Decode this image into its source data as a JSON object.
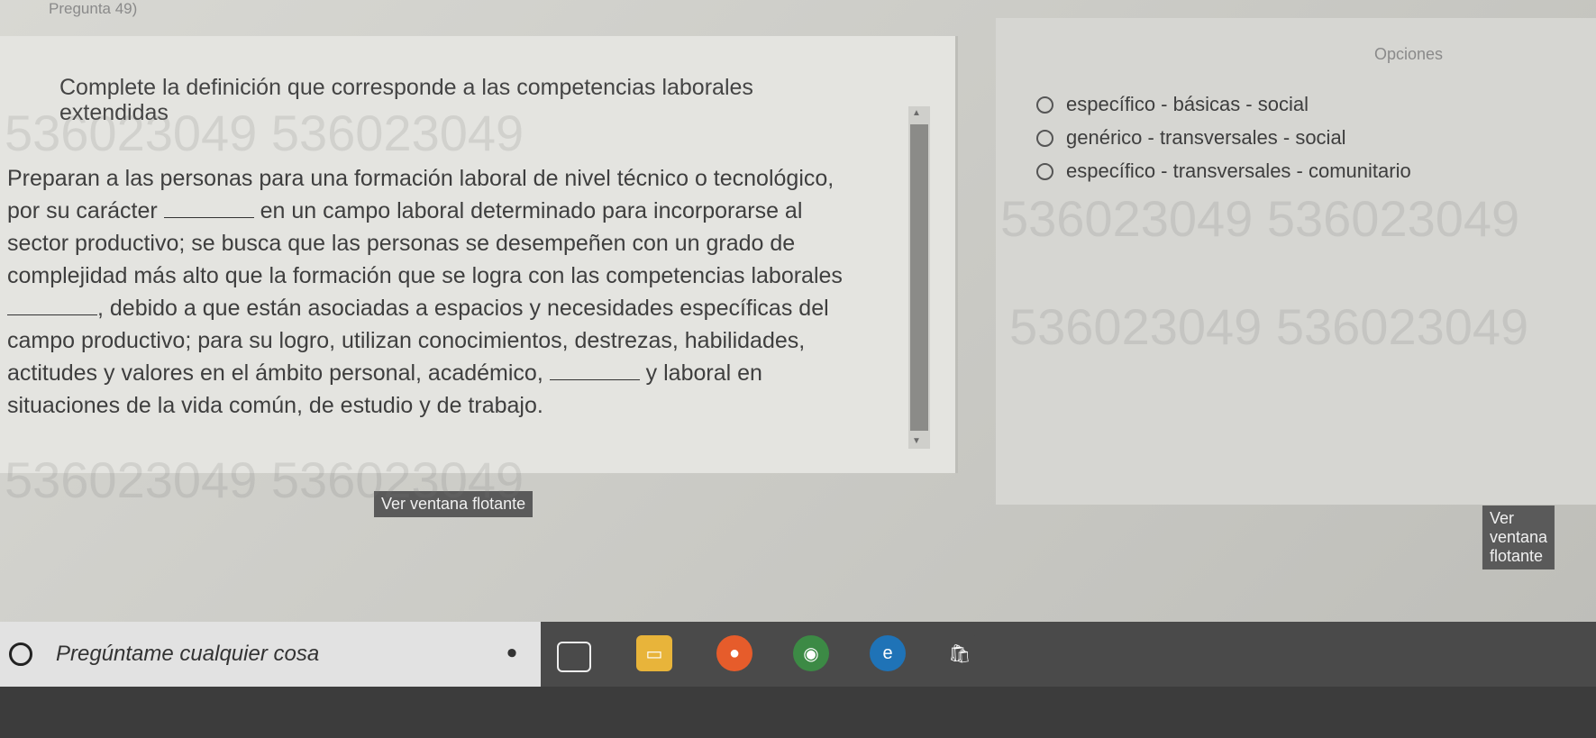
{
  "question": {
    "number_label": "Pregunta 49)",
    "instruction": "Complete la definición que corresponde a las competencias laborales extendidas",
    "paragraph_parts": [
      "Preparan a las personas para una formación laboral de nivel técnico o tecnológico, por su carácter ",
      " en un campo laboral determinado para incorporarse al sector productivo; se busca que las personas se desempeñen con un grado de complejidad más alto que la formación que se logra con las competencias laborales ",
      ", debido a que están asociadas a espacios y necesidades específicas del campo productivo; para su logro, utilizan conocimientos, destrezas, habilidades, actitudes y valores en el ámbito personal, académico, ",
      " y laboral en situaciones de la vida común, de estudio y de trabajo."
    ],
    "float_button_label": "Ver ventana flotante"
  },
  "options_panel": {
    "title": "Opciones",
    "options": [
      "específico - básicas - social",
      "genérico - transversales - social",
      "específico - transversales - comunitario"
    ],
    "float_button_label": "Ver ventana flotante"
  },
  "watermark": {
    "text": "536023049 536023049"
  },
  "taskbar": {
    "search_placeholder": "Pregúntame cualquier cosa",
    "icons": [
      "microphone-icon",
      "task-view-icon",
      "file-explorer-icon",
      "firefox-icon",
      "chrome-icon",
      "edge-icon",
      "store-icon"
    ]
  }
}
